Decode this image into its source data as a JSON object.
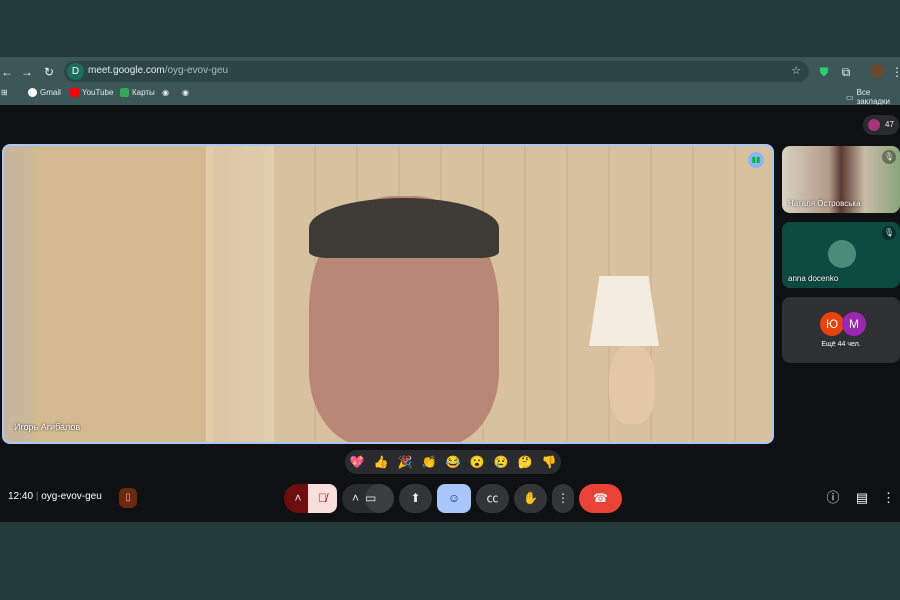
{
  "browser": {
    "url_host": "meet.google.com",
    "url_path": "/oyg-evov-geu",
    "bookmarks": [
      "Gmail",
      "YouTube",
      "Карты"
    ],
    "all_bookmarks": "Все закладки"
  },
  "meet": {
    "participant_count": "47",
    "main_speaker": "Игорь Агибалов",
    "tiles": [
      {
        "name": "Наталя Островська"
      },
      {
        "name": "anna docenko"
      }
    ],
    "more": {
      "avatars": [
        "Ю",
        "M"
      ],
      "label": "Ещё 44 чел."
    },
    "reactions": [
      "💖",
      "👍",
      "🎉",
      "👏",
      "😂",
      "😮",
      "😢",
      "🤔",
      "👎"
    ],
    "time": "12:40",
    "meeting_code": "oyg-evov-geu"
  },
  "colors": {
    "accent": "#a8c7fa",
    "end_call": "#ea4335",
    "mic_off": "#f9dedc"
  }
}
